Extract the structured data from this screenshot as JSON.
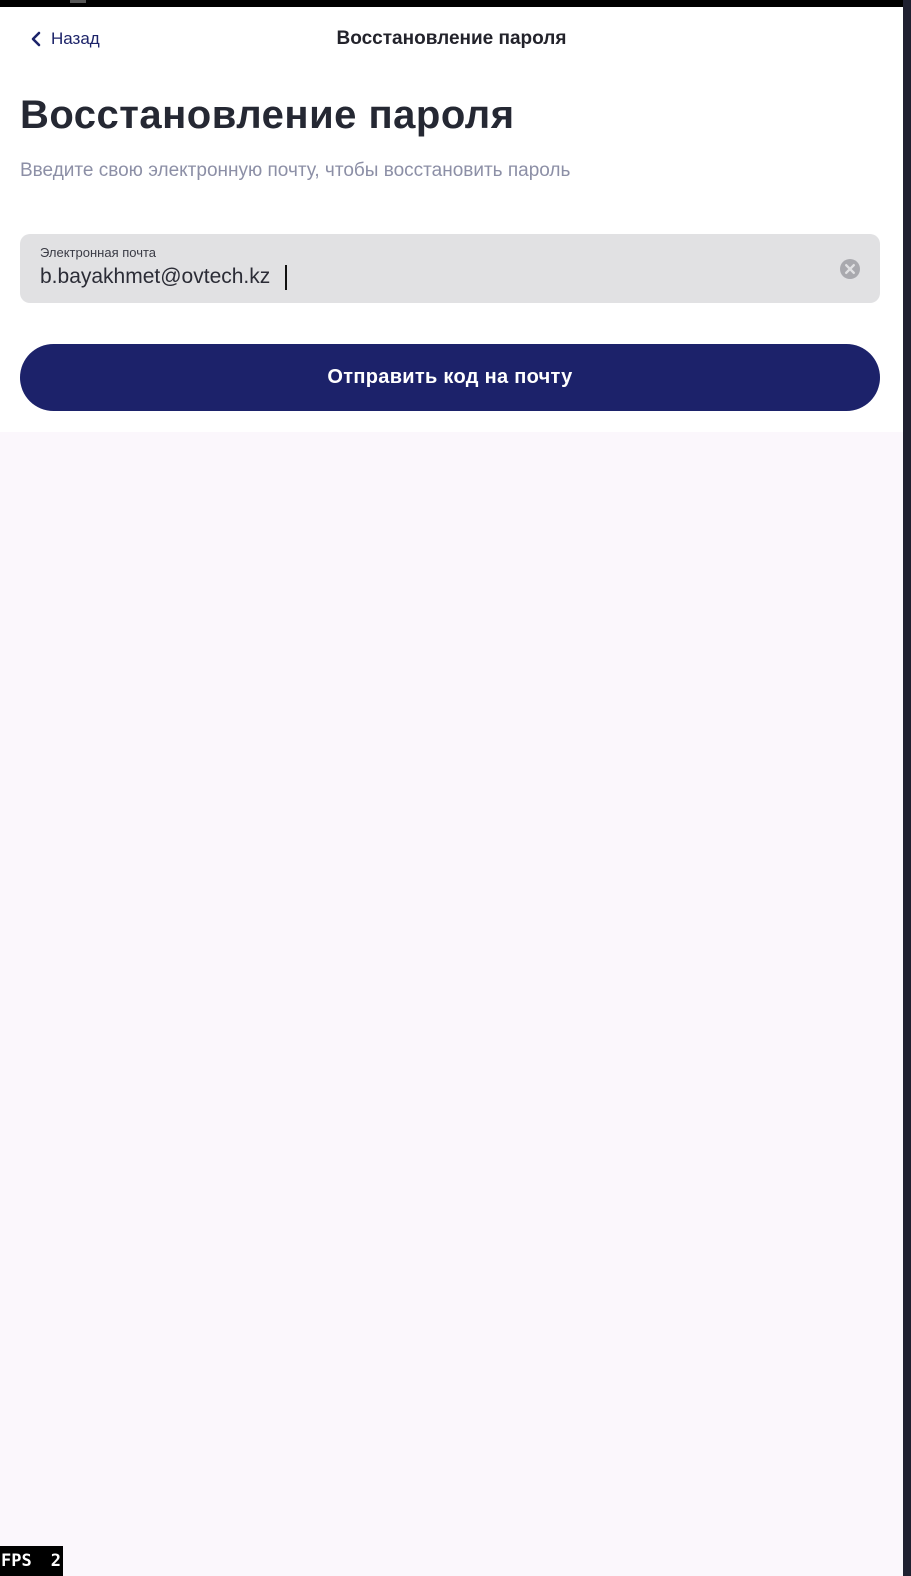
{
  "nav": {
    "back_label": "Назад",
    "title": "Восстановление пароля"
  },
  "page": {
    "heading": "Восстановление пароля",
    "subtitle": "Введите свою электронную почту, чтобы восстановить пароль"
  },
  "email_field": {
    "label": "Электронная почта",
    "value": "b.bayakhmet@ovtech.kz",
    "clear_icon": "close-circle-icon"
  },
  "submit": {
    "label": "Отправить код на почту"
  },
  "fps_overlay": {
    "label": "FPS",
    "value": "2"
  },
  "colors": {
    "accent": "#1c226a",
    "background": "#fbf7fc",
    "field_bg": "#e1e1e3",
    "subtitle": "#8c8fa6"
  }
}
